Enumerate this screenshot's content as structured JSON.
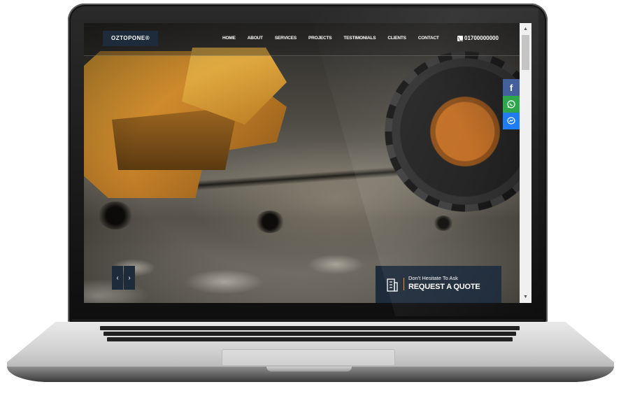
{
  "site": {
    "logo": "OZTOPONE®",
    "nav": [
      "HOME",
      "ABOUT",
      "SERVICES",
      "PROJECTS",
      "TESTIMONIALS",
      "CLIENTS",
      "CONTACT"
    ],
    "phone": "01700000000"
  },
  "social": {
    "icons": [
      "facebook-icon",
      "whatsapp-icon",
      "messenger-icon"
    ],
    "colors": {
      "facebook": "#3b5998",
      "whatsapp": "#25a244",
      "messenger": "#1877f2"
    }
  },
  "slider": {
    "prev": "‹",
    "next": "›"
  },
  "quote": {
    "tagline": "Don't Hesitate To Ask",
    "cta": "REQUEST A QUOTE"
  },
  "colors": {
    "brand_navy": "#1e2b3a",
    "accent_orange": "#e88a2a"
  },
  "scrollbar": {
    "up": "▲",
    "down": "▼"
  }
}
